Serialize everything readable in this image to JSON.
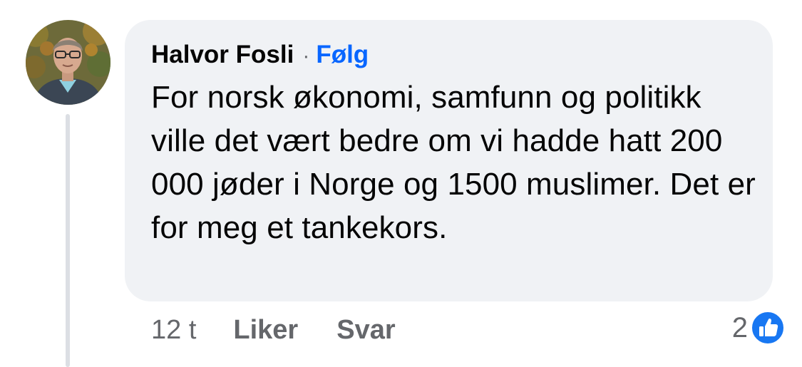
{
  "comment": {
    "author": "Halvor Fosli",
    "separator": "·",
    "follow_label": "Følg",
    "text": "For norsk økonomi, samfunn og politikk ville det vært bedre om vi hadde hatt 200 000 jøder i Norge og 1500 muslimer. Det er for meg et tankekors.",
    "avatar_icon": "profile-photo",
    "timestamp": "12 t",
    "like_label": "Liker",
    "reply_label": "Svar",
    "reaction_count": "2",
    "reaction_icon": "thumbs-up-icon"
  },
  "colors": {
    "bubble": "#f0f2f5",
    "follow": "#0866ff",
    "muted": "#65676b",
    "like_badge": "#1877f2"
  }
}
